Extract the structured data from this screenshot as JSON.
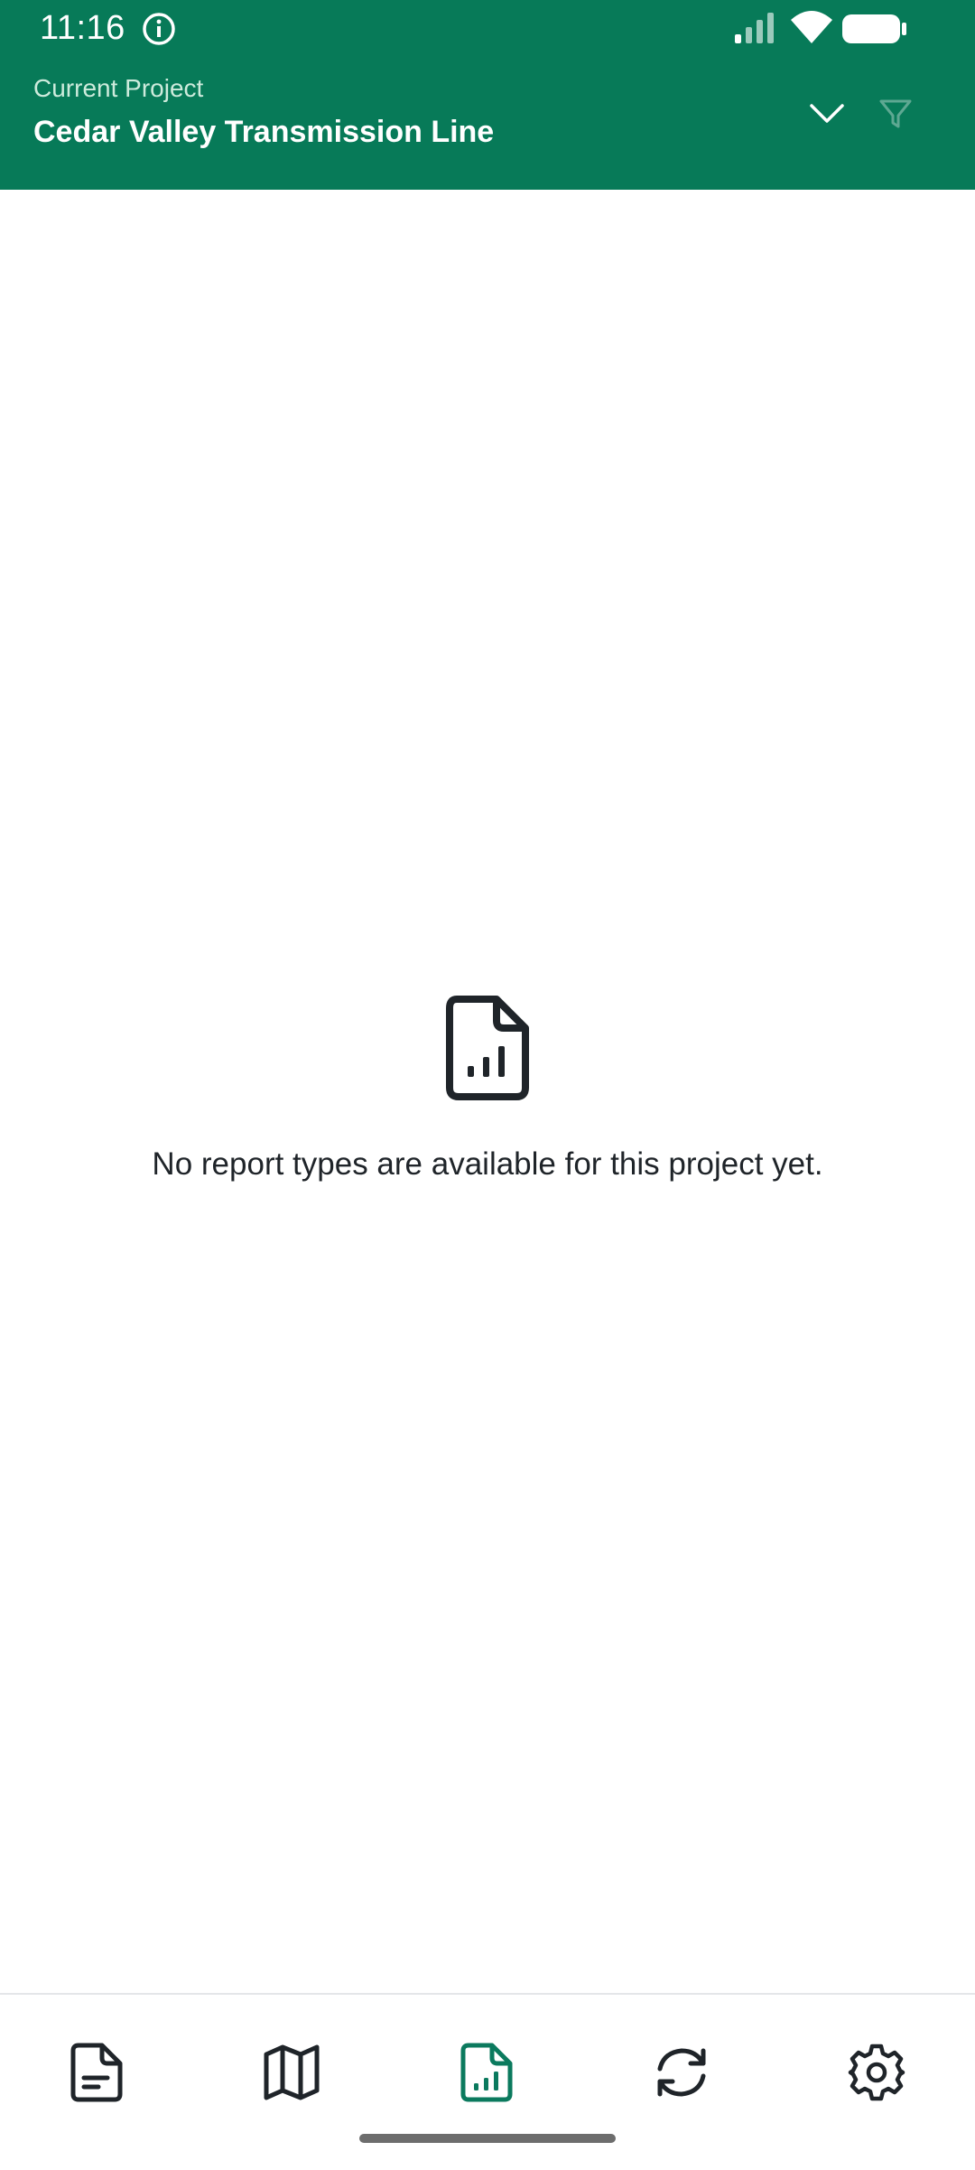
{
  "status_bar": {
    "time": "11:16"
  },
  "header": {
    "label": "Current Project",
    "project_name": "Cedar Valley Transmission Line"
  },
  "empty_state": {
    "icon": "report-chart-file-icon",
    "message": "No report types are available for this project yet."
  },
  "bottom_nav": {
    "items": [
      {
        "icon": "document-icon",
        "active": false
      },
      {
        "icon": "map-icon",
        "active": false
      },
      {
        "icon": "report-chart-file-icon",
        "active": true
      },
      {
        "icon": "sync-icon",
        "active": false
      },
      {
        "icon": "gear-icon",
        "active": false
      }
    ]
  },
  "colors": {
    "primary": "#077A58",
    "active_icon": "#0B7A5E",
    "inactive_icon": "#1f2429",
    "text": "#1f2429"
  }
}
